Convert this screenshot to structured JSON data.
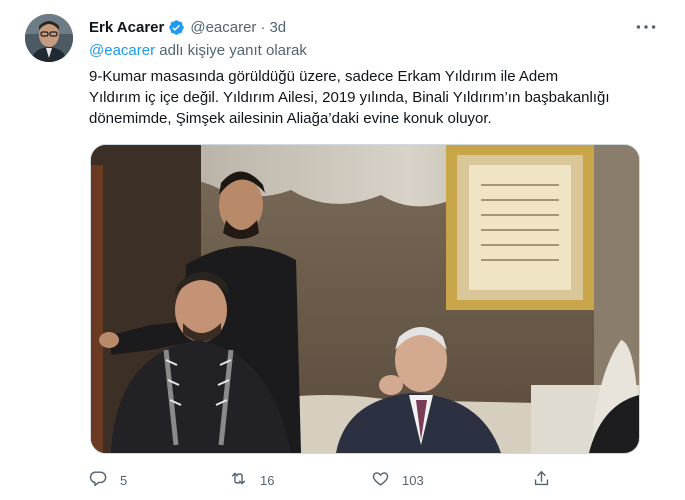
{
  "tweet": {
    "display_name": "Erk Acarer",
    "handle": "@eacarer",
    "separator": "·",
    "time": "3d",
    "reply_prefix": "@eacarer",
    "reply_suffix": " adlı kişiye yanıt olarak",
    "body": "9-Kumar masasında görüldüğü üzere, sadece Erkam Yıldırım ile Adem\nYıldırım iç içe değil. Yıldırım Ailesi, 2019 yılında, Binali Yıldırım’ın başbakanlığı\ndönemimde, Şimşek ailesinin Aliağa’daki evine konuk oluyor.",
    "icons": {
      "verified": "verified-badge-icon",
      "more": "more-options-icon",
      "reply": "reply-icon",
      "retweet": "retweet-icon",
      "like": "like-icon",
      "share": "share-icon"
    },
    "colors": {
      "accent": "#1d9bf0",
      "secondary_text": "#536471",
      "primary_text": "#0f1419"
    }
  },
  "actions": {
    "replies": "5",
    "retweets": "16",
    "likes": "103"
  }
}
